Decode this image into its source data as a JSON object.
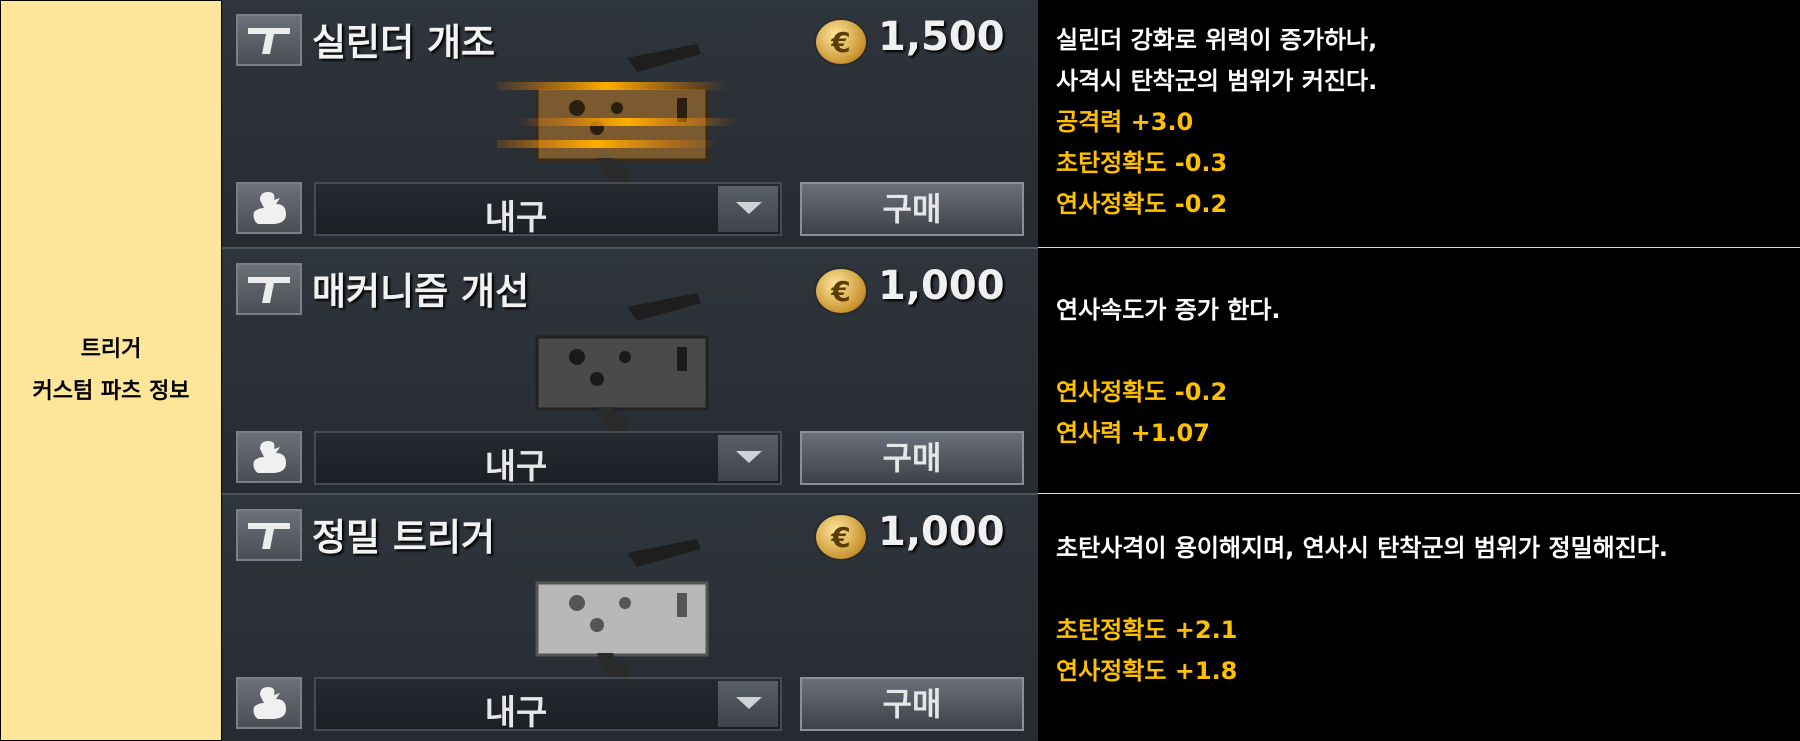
{
  "category": {
    "line1": "트리거",
    "line2": "커스텀 파츠 정보"
  },
  "items": [
    {
      "name": "실린더 개조",
      "price": "1,500",
      "durability_label": "내구",
      "buy_label": "구매",
      "desc_lines": [
        "실린더 강화로 위력이 증가하나,",
        "사격시 탄착군의 범위가 커진다."
      ],
      "stats": [
        "공격력 +3.0",
        "초탄정확도 -0.3",
        "연사정확도 -0.2"
      ],
      "gun_color": "#7a5a2e"
    },
    {
      "name": "매커니즘 개선",
      "price": "1,000",
      "durability_label": "내구",
      "buy_label": "구매",
      "desc_lines": [
        "연사속도가 증가 한다."
      ],
      "stats": [
        "연사정확도 -0.2",
        "연사력 +1.07"
      ],
      "gun_color": "#4a4a4a"
    },
    {
      "name": "정밀 트리거",
      "price": "1,000",
      "durability_label": "내구",
      "buy_label": "구매",
      "desc_lines": [
        "초탄사격이 용이해지며, 연사시 탄착군의 범위가 정밀해진다."
      ],
      "stats": [
        "초탄정확도 +2.1",
        "연사정확도 +1.8"
      ],
      "gun_color": "#b8b8b8"
    }
  ],
  "currency_symbol": "€",
  "colors": {
    "category_bg": "#fde599",
    "stat_text": "#ffc000",
    "desc_text": "#ffffff"
  }
}
